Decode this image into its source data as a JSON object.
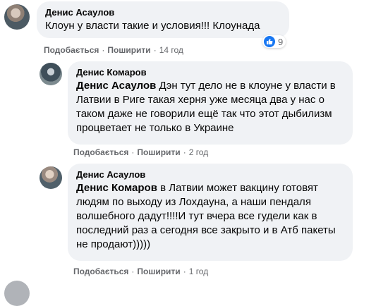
{
  "comments": [
    {
      "author": "Денис Асаулов",
      "mention": "",
      "text": "Клоун у власти такие и условия!!! Клоунада",
      "like_label": "Подобається",
      "reply_label": "Поширити",
      "time": "14 год",
      "reaction_count": "9"
    },
    {
      "author": "Денис Комаров",
      "mention": "Денис Асаулов",
      "text": " Дэн тут дело не в клоуне у власти в Латвии в Риге такая херня уже месяца два у нас о таком даже не говорили ещё так что этот дыбилизм процветает не только в Украине",
      "like_label": "Подобається",
      "reply_label": "Поширити",
      "time": "2 год"
    },
    {
      "author": "Денис Асаулов",
      "mention": "Денис Комаров",
      "text": " в Латвии может вакцину готовят людям по выходу из Лохдауна, а наши пендаля волшебного дадут!!!!И тут вчера все гудели как в последний раз а сегодня все закрыто и в Атб пакеты не продают)))))",
      "like_label": "Подобається",
      "reply_label": "Поширити",
      "time": "1 год"
    }
  ],
  "separator": "·",
  "icons": {
    "reaction": "like-icon",
    "brand_blue": "#1877f2"
  }
}
